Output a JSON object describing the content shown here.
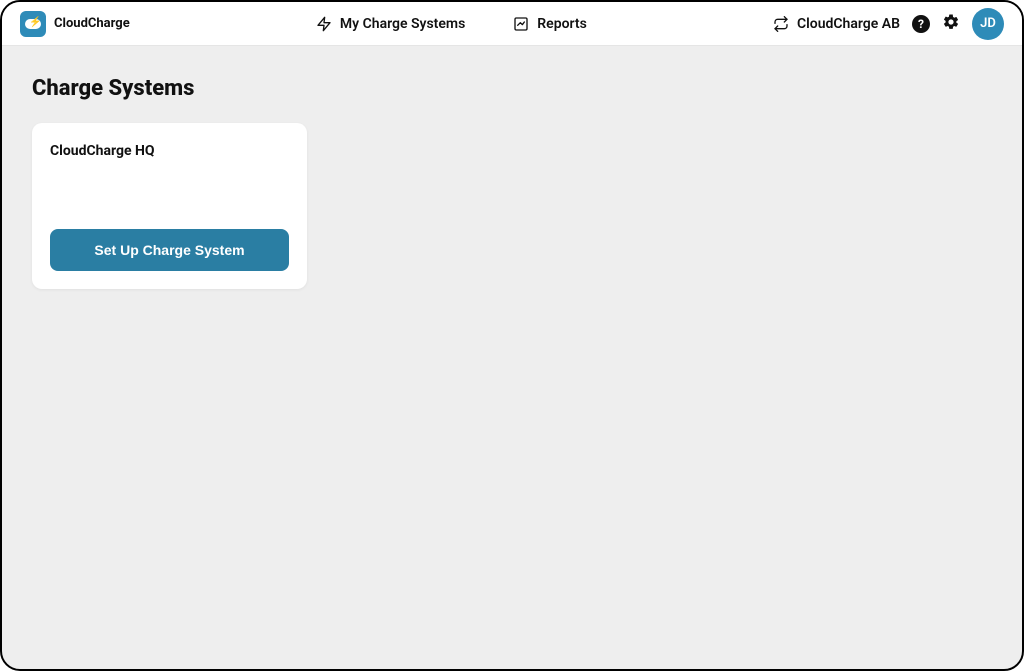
{
  "brand": {
    "name": "CloudCharge"
  },
  "nav": {
    "charge_systems": "My Charge Systems",
    "reports": "Reports"
  },
  "header": {
    "org_name": "CloudCharge AB",
    "avatar_initials": "JD"
  },
  "page": {
    "title": "Charge Systems"
  },
  "systems": [
    {
      "name": "CloudCharge HQ",
      "action_label": "Set Up Charge System"
    }
  ],
  "colors": {
    "accent": "#2a7ea3",
    "logo_bg": "#2e8bb8"
  }
}
